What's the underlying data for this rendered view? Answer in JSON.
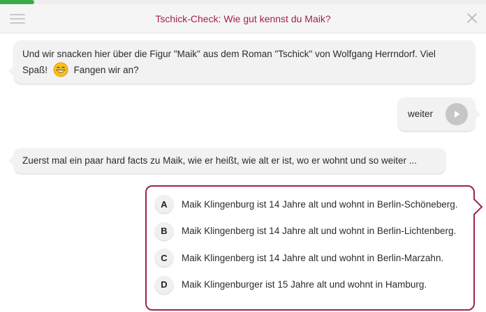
{
  "progress": {
    "fraction": 0.07,
    "color": "#3aaa4a"
  },
  "header": {
    "title": "Tschick-Check: Wie gut kennst du Maik?",
    "menu_icon": "hamburger-menu-icon",
    "close_icon": "close-icon"
  },
  "messages": {
    "intro_line1": "Und wir snacken hier über die Figur \"Maik\" aus dem Roman \"Tschick\" von Wolfgang Herrndorf. Viel",
    "intro_line2a": "Spaß!",
    "intro_emoji": "grinning-face-emoji",
    "intro_line2b": "Fangen wir an?",
    "reply_label": "weiter",
    "facts": "Zuerst mal ein paar hard facts zu Maik, wie er heißt, wie alt er ist, wo er wohnt und so weiter ..."
  },
  "answers": [
    {
      "letter": "A",
      "text": "Maik Klingenburg ist 14 Jahre alt und wohnt in Berlin-Schöneberg."
    },
    {
      "letter": "B",
      "text": "Maik Klingenberg ist 14 Jahre alt und wohnt in Berlin-Lichtenberg."
    },
    {
      "letter": "C",
      "text": "Maik Klingenberg ist 14 Jahre alt und wohnt in Berlin-Marzahn."
    },
    {
      "letter": "D",
      "text": "Maik Klingenburger ist 15 Jahre alt und wohnt in Hamburg."
    }
  ],
  "colors": {
    "accent": "#a3214f",
    "answer_border": "#9d2447",
    "bubble": "#f2f2f2"
  }
}
